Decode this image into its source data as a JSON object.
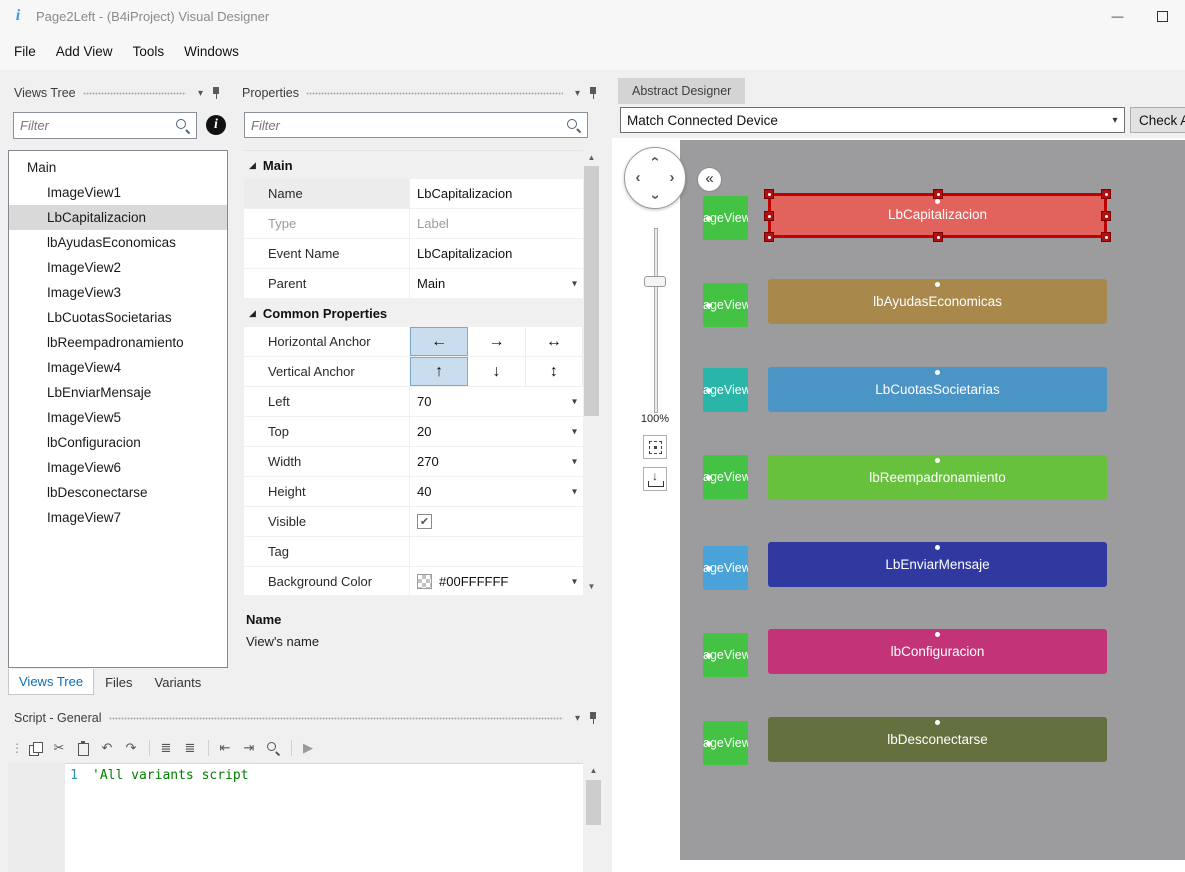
{
  "glyphs": {
    "dropdown": "▾",
    "section_expanded": "◢",
    "check_mark": "✔",
    "scroll_up": "▲",
    "scroll_down": "▼",
    "chevron_left": "‹",
    "chevron_right": "›",
    "minimize": "—",
    "app_logo": "i",
    "info": "i",
    "down_arrow": "↓"
  },
  "titlebar": {
    "title": "Page2Left - (B4iProject) Visual Designer"
  },
  "menubar": {
    "items": [
      {
        "label": "File"
      },
      {
        "label": "Add View"
      },
      {
        "label": "Tools"
      },
      {
        "label": "Windows"
      }
    ]
  },
  "views_tree": {
    "header": "Views Tree",
    "filter_placeholder": "Filter",
    "items": [
      {
        "label": "Main"
      },
      {
        "label": "ImageView1"
      },
      {
        "label": "LbCapitalizacion",
        "selected": true
      },
      {
        "label": "lbAyudasEconomicas"
      },
      {
        "label": "ImageView2"
      },
      {
        "label": "ImageView3"
      },
      {
        "label": "LbCuotasSocietarias"
      },
      {
        "label": "lbReempadronamiento"
      },
      {
        "label": "ImageView4"
      },
      {
        "label": "LbEnviarMensaje"
      },
      {
        "label": "ImageView5"
      },
      {
        "label": "lbConfiguracion"
      },
      {
        "label": "ImageView6"
      },
      {
        "label": "lbDesconectarse"
      },
      {
        "label": "ImageView7"
      }
    ],
    "tabs": [
      {
        "label": "Views Tree",
        "active": true
      },
      {
        "label": "Files"
      },
      {
        "label": "Variants"
      }
    ]
  },
  "properties": {
    "header": "Properties",
    "filter_placeholder": "Filter",
    "section_main": "Main",
    "section_common": "Common Properties",
    "rows": {
      "name": {
        "label": "Name",
        "value": "LbCapitalizacion"
      },
      "type": {
        "label": "Type",
        "value": "Label"
      },
      "event_name": {
        "label": "Event Name",
        "value": "LbCapitalizacion"
      },
      "parent": {
        "label": "Parent",
        "value": "Main"
      },
      "h_anchor": {
        "label": "Horizontal Anchor",
        "options": [
          "←",
          "→",
          "↔"
        ],
        "selected": 0
      },
      "v_anchor": {
        "label": "Vertical Anchor",
        "options": [
          "↑",
          "↓",
          "↕"
        ],
        "selected": 0
      },
      "left": {
        "label": "Left",
        "value": "70"
      },
      "top": {
        "label": "Top",
        "value": "20"
      },
      "width": {
        "label": "Width",
        "value": "270"
      },
      "height": {
        "label": "Height",
        "value": "40"
      },
      "visible": {
        "label": "Visible",
        "checked": true
      },
      "tag": {
        "label": "Tag",
        "value": ""
      },
      "background_color": {
        "label": "Background Color",
        "value": "#00FFFFFF"
      }
    },
    "description": {
      "title": "Name",
      "text": "View's name"
    }
  },
  "script": {
    "header": "Script - General",
    "toolbar": {
      "grip": "⋮",
      "cut": "✂",
      "undo": "↶",
      "redo": "↷",
      "comment": "≣",
      "uncomment": "≣",
      "outdent": "⇤",
      "indent": "⇥",
      "run": "▶"
    },
    "line_number": "1",
    "code": "'All variants script"
  },
  "designer": {
    "tab": "Abstract Designer",
    "device_selector": "Match Connected Device",
    "check_button": "Check A",
    "zoom_label": "100%",
    "collapse_button": "«",
    "canvas": {
      "selection_color": "#c00000",
      "image_views": [
        {
          "label": "ageView",
          "color": "#44c244"
        },
        {
          "label": "ageView",
          "color": "#44c244"
        },
        {
          "label": "ageView",
          "color": "#29b6a8"
        },
        {
          "label": "ageView",
          "color": "#44c244"
        },
        {
          "label": "ageView",
          "color": "#4aa3d8"
        },
        {
          "label": "ageView",
          "color": "#44c244"
        },
        {
          "label": "ageView",
          "color": "#44c244"
        }
      ],
      "labels": [
        {
          "label": "LbCapitalizacion",
          "color": "#e2625d",
          "selected": true
        },
        {
          "label": "lbAyudasEconomicas",
          "color": "#a8894b"
        },
        {
          "label": "LbCuotasSocietarias",
          "color": "#4b94c6"
        },
        {
          "label": "lbReempadronamiento",
          "color": "#67c13c"
        },
        {
          "label": "LbEnviarMensaje",
          "color": "#3039a0"
        },
        {
          "label": "lbConfiguracion",
          "color": "#c23377"
        },
        {
          "label": "lbDesconectarse",
          "color": "#64713f"
        }
      ]
    }
  }
}
